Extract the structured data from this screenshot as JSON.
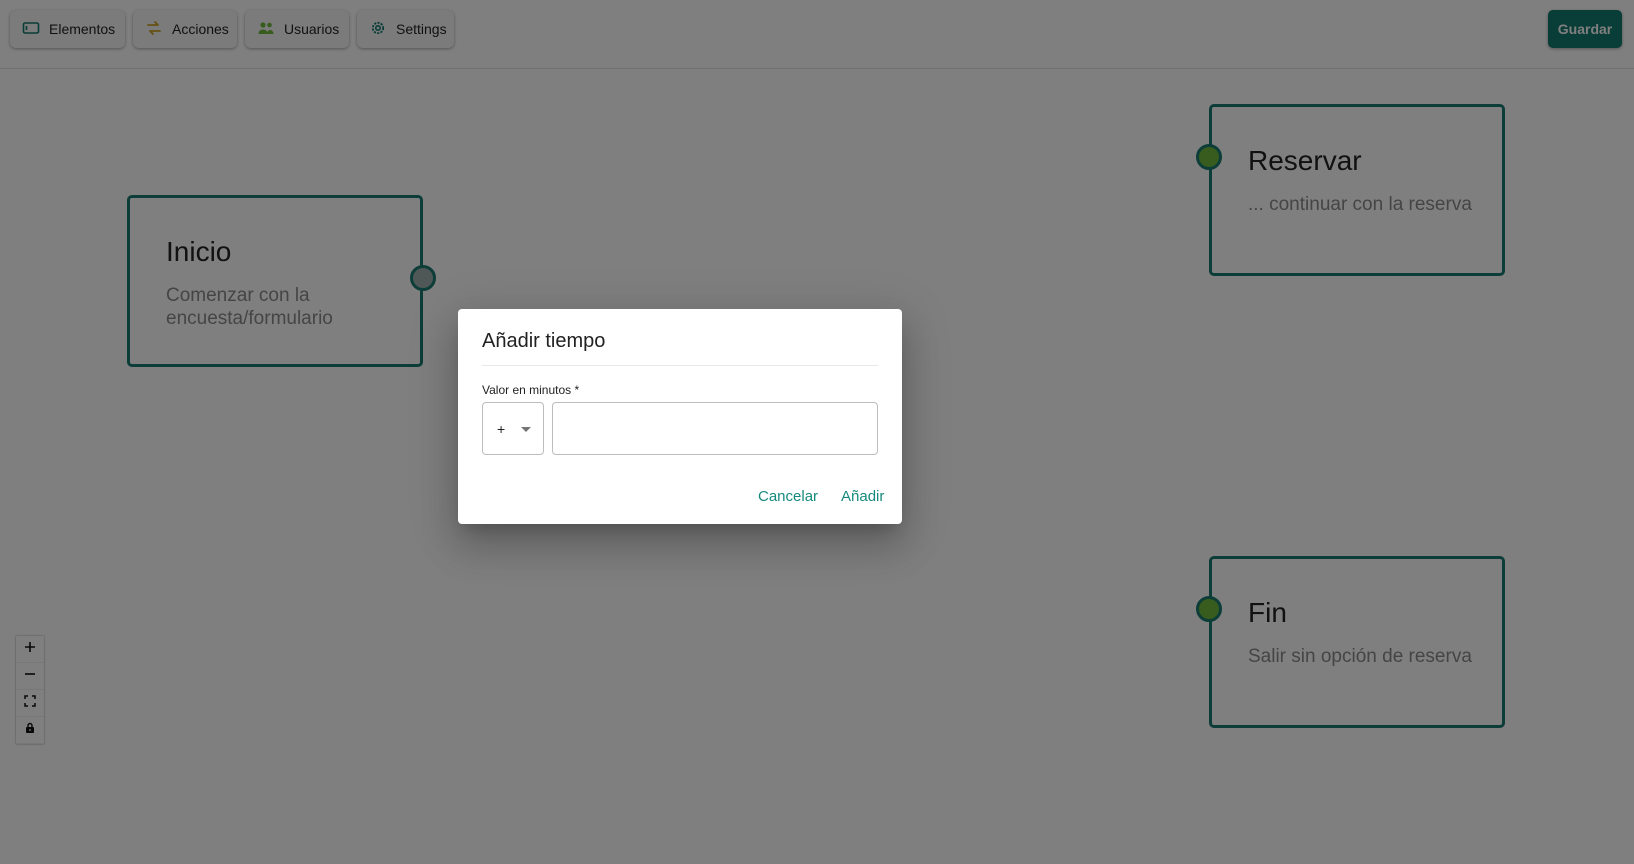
{
  "toolbar": {
    "buttons": [
      {
        "label": "Elementos",
        "icon": "element-box-icon"
      },
      {
        "label": "Acciones",
        "icon": "swap-arrows-icon"
      },
      {
        "label": "Usuarios",
        "icon": "users-icon"
      },
      {
        "label": "Settings",
        "icon": "gear-icon"
      }
    ],
    "save_label": "Guardar"
  },
  "nodes": [
    {
      "id": "inicio",
      "title": "Inicio",
      "description": "Comenzar con la encuesta/formulario"
    },
    {
      "id": "reservar",
      "title": "Reservar",
      "description": "... continuar con la reserva"
    },
    {
      "id": "fin",
      "title": "Fin",
      "description": "Salir sin opción de reserva"
    }
  ],
  "zoom_controls": [
    "plus-icon",
    "minus-icon",
    "fit-view-icon",
    "lock-icon"
  ],
  "dialog": {
    "title": "Añadir tiempo",
    "field_label": "Valor en minutos *",
    "sign_value": "+",
    "minutes_value": "",
    "cancel_label": "Cancelar",
    "add_label": "Añadir"
  },
  "colors": {
    "accent": "#127a70",
    "node_border": "#1a7a70",
    "handle_in": "#6fb83a",
    "link": "#168a7e"
  }
}
